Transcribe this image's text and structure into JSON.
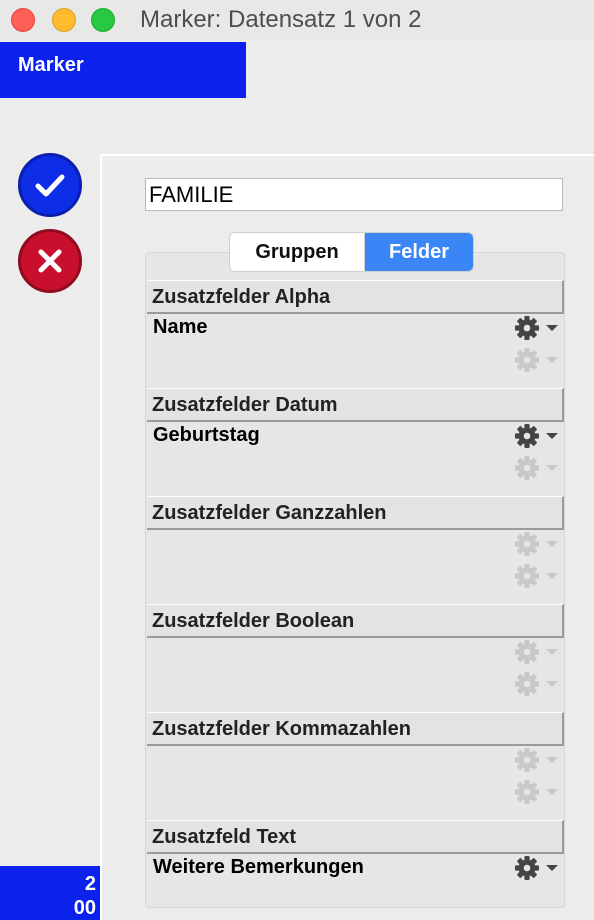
{
  "window": {
    "title": "Marker: Datensatz 1 von 2"
  },
  "tab": {
    "label": "Marker"
  },
  "actions": {
    "confirm": "checkmark-icon",
    "cancel": "x-icon"
  },
  "record_counter": {
    "line1": "2",
    "line2": "00"
  },
  "name_field": {
    "value": "FAMILIE"
  },
  "segments": {
    "groups": "Gruppen",
    "fields": "Felder",
    "selected": "Felder"
  },
  "sections": [
    {
      "title": "Zusatzfelder Alpha",
      "rows": [
        {
          "label": "Name",
          "active": true
        },
        {
          "label": "",
          "active": false
        }
      ]
    },
    {
      "title": "Zusatzfelder Datum",
      "rows": [
        {
          "label": "Geburtstag",
          "active": true
        },
        {
          "label": "",
          "active": false
        }
      ]
    },
    {
      "title": "Zusatzfelder Ganzzahlen",
      "rows": [
        {
          "label": "",
          "active": false
        },
        {
          "label": "",
          "active": false
        }
      ]
    },
    {
      "title": "Zusatzfelder Boolean",
      "rows": [
        {
          "label": "",
          "active": false
        },
        {
          "label": "",
          "active": false
        }
      ]
    },
    {
      "title": "Zusatzfelder Kommazahlen",
      "rows": [
        {
          "label": "",
          "active": false
        },
        {
          "label": "",
          "active": false
        }
      ]
    },
    {
      "title": "Zusatzfeld Text",
      "rows": [
        {
          "label": "Weitere Bemerkungen",
          "active": true
        }
      ]
    }
  ],
  "colors": {
    "accent_blue": "#0a22ec",
    "segment_selected": "#3a86f7",
    "cancel_red": "#c8102e",
    "gear_active": "#444444",
    "gear_inactive": "#c8c8c8"
  }
}
